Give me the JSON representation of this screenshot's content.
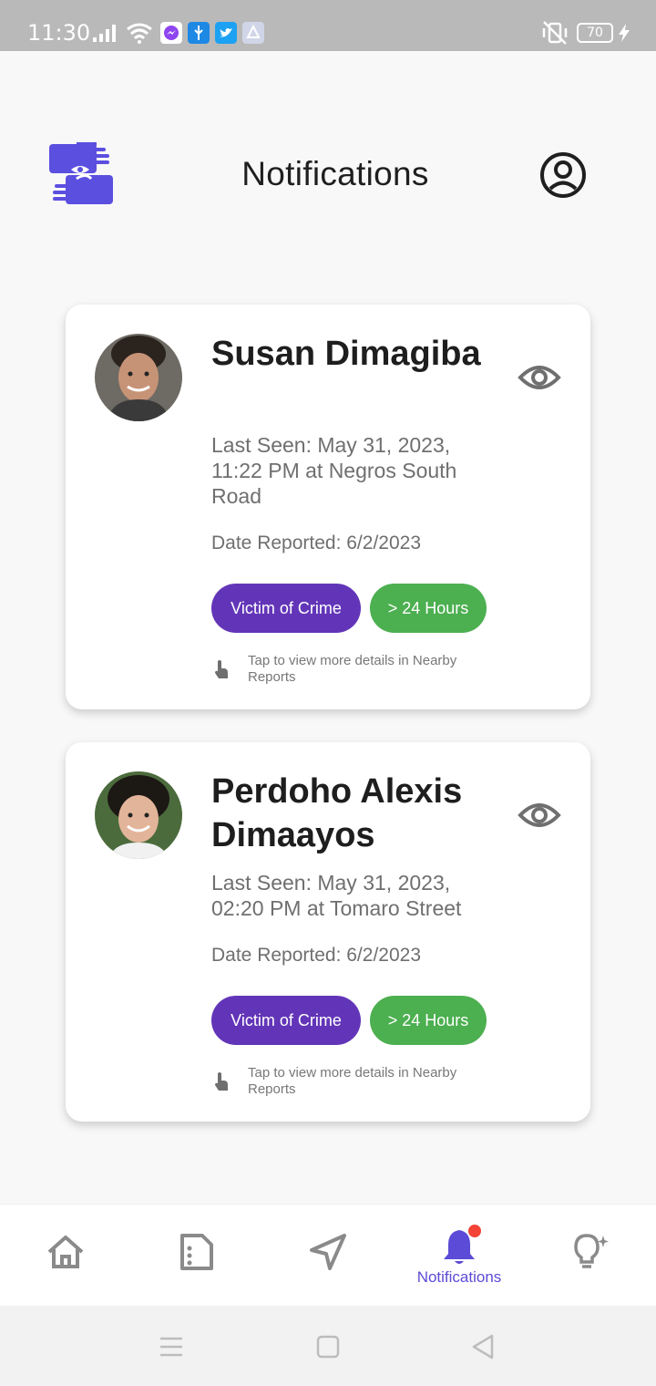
{
  "status_bar": {
    "time": "11:30",
    "battery": "70",
    "icons": [
      "signal-icon",
      "wifi-icon",
      "messenger-icon",
      "usb-icon",
      "twitter-icon",
      "app-icon",
      "vibrate-off-icon",
      "battery-icon",
      "charging-icon"
    ]
  },
  "header": {
    "title": "Notifications",
    "logo": "hands-logo",
    "profile_icon": "user-circle-icon"
  },
  "notifications": [
    {
      "name": "Susan Dimagiba",
      "last_seen": "Last Seen: May 31, 2023, 11:22 PM at Negros South Road",
      "date_reported": "Date Reported: 6/2/2023",
      "tags": [
        "Victim of Crime",
        "> 24 Hours"
      ],
      "hint": "Tap to view more details in Nearby Reports"
    },
    {
      "name": "Perdoho Alexis Dimaayos",
      "last_seen": "Last Seen: May 31, 2023, 02:20 PM at Tomaro Street",
      "date_reported": "Date Reported: 6/2/2023",
      "tags": [
        "Victim of Crime",
        "> 24 Hours"
      ],
      "hint": "Tap to view more details in Nearby Reports"
    }
  ],
  "bottom_nav": {
    "items": [
      {
        "icon": "home-icon",
        "label": ""
      },
      {
        "icon": "document-icon",
        "label": ""
      },
      {
        "icon": "send-icon",
        "label": ""
      },
      {
        "icon": "bell-icon",
        "label": "Notifications",
        "active": true
      },
      {
        "icon": "lightbulb-icon",
        "label": ""
      }
    ]
  },
  "colors": {
    "accent": "#5b4bd6",
    "crime_chip": "#6235b8",
    "hours_chip": "#4caf50",
    "badge": "#f44336"
  }
}
